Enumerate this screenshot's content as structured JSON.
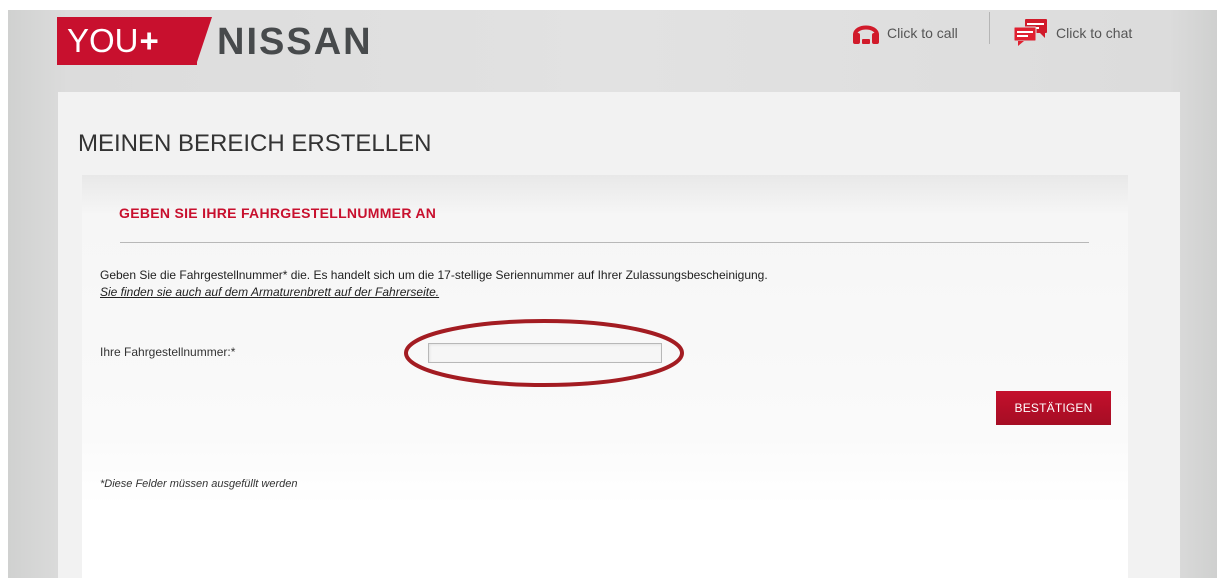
{
  "header": {
    "logo": {
      "you": "YOU",
      "plus": "+",
      "brand": "NISSAN"
    },
    "call": {
      "label": "Click to call",
      "icon": "headset-icon"
    },
    "chat": {
      "label": "Click to chat",
      "icon": "chat-bubbles-icon"
    }
  },
  "page": {
    "title": "MEINEN BEREICH ERSTELLEN"
  },
  "form": {
    "section_title": "GEBEN SIE IHRE FAHRGESTELLNUMMER AN",
    "instruction": "Geben Sie die Fahrgestellnummer* die. Es handelt sich um die 17-stellige Seriennummer auf Ihrer Zulassungsbescheinigung.",
    "instruction_link": "Sie finden sie auch auf dem Armaturenbrett auf der Fahrerseite.",
    "vin_label": "Ihre Fahrgestellnummer:*",
    "vin_value": "",
    "vin_placeholder": "",
    "confirm_label": "BESTÄTIGEN",
    "required_note": "*Diese Felder müssen ausgefüllt werden"
  },
  "colors": {
    "brand_red": "#c8102e",
    "highlight_ring": "#a31c22",
    "background": "#dcdcdc"
  }
}
